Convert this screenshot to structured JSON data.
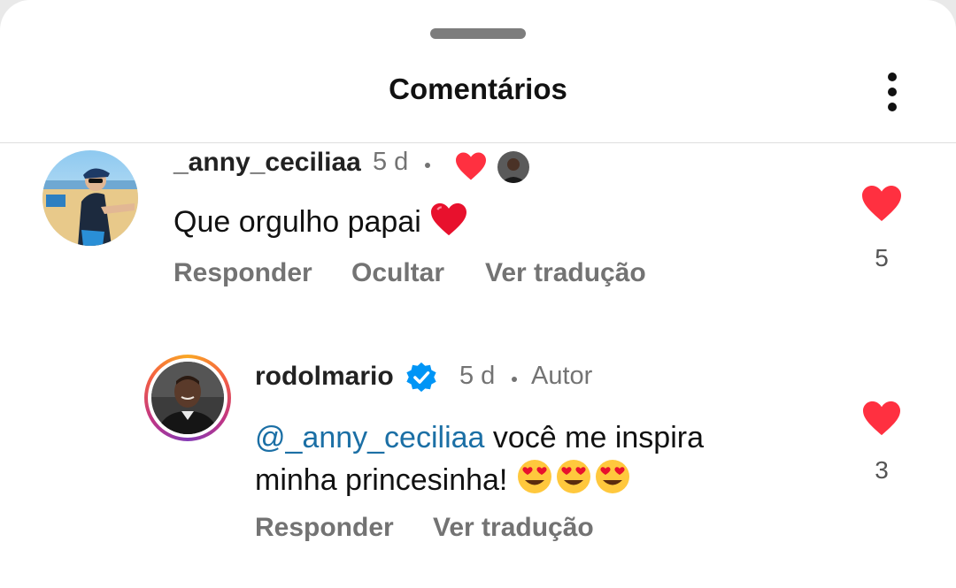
{
  "header": {
    "title": "Comentários"
  },
  "comments": [
    {
      "username": "_anny_ceciliaa",
      "time": "5 d",
      "text": "Que orgulho papai",
      "actions": {
        "reply": "Responder",
        "hide": "Ocultar",
        "translate": "Ver tradução"
      },
      "like_count": "5",
      "author_liked": true
    },
    {
      "username": "rodolmario",
      "verified": true,
      "time": "5 d",
      "badge": "Autor",
      "mention": "@_anny_ceciliaa",
      "text_line1": " você me inspira",
      "text_line2": "minha princesinha!",
      "actions": {
        "reply": "Responder",
        "translate": "Ver tradução"
      },
      "like_count": "3"
    }
  ],
  "colors": {
    "heart": "#ff3040",
    "verified": "#0095f6",
    "mention": "#1b6fa5",
    "muted": "#737373"
  }
}
